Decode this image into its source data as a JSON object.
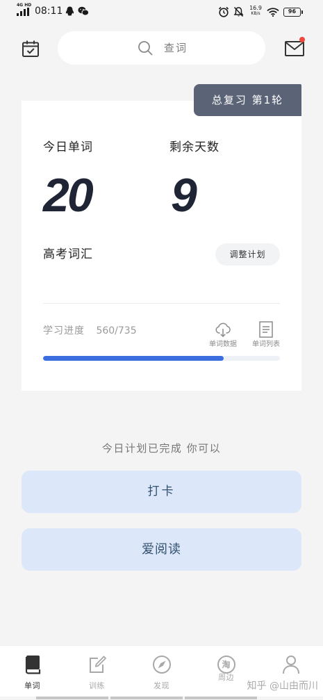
{
  "status_bar": {
    "network": "4G HD",
    "time": "08:11",
    "speed_value": "16.9",
    "speed_unit": "KB/s",
    "battery": "96"
  },
  "header": {
    "search_placeholder": "查词",
    "has_unread_mail": true
  },
  "plan_card": {
    "tag": "总复习 第1轮",
    "today_words_label": "今日单词",
    "today_words_value": "20",
    "remaining_days_label": "剩余天数",
    "remaining_days_value": "9",
    "book_name": "高考词汇",
    "adjust_button": "调整计划",
    "progress_label": "学习进度",
    "progress_text": "560/735",
    "progress_done": 560,
    "progress_total": 735,
    "word_data_label": "单词数据",
    "word_list_label": "单词列表"
  },
  "completion_message": "今日计划已完成 你可以",
  "actions": {
    "checkin_label": "打卡",
    "reading_label": "爱阅读"
  },
  "tabs": [
    {
      "label": "单词",
      "icon": "book-icon",
      "active": true
    },
    {
      "label": "训练",
      "icon": "edit-icon",
      "active": false
    },
    {
      "label": "发现",
      "icon": "compass-icon",
      "active": false
    },
    {
      "label": "周边",
      "icon": "tao-icon",
      "icon_text": "淘",
      "active": false
    },
    {
      "icon": "person-icon",
      "active": false
    }
  ],
  "watermark": "知乎 @山由而川",
  "colors": {
    "page_bg": "#f4f4f4",
    "card_bg": "#ffffff",
    "tag_bg": "#5b6477",
    "number": "#1f2535",
    "accent": "#3d6ee0",
    "track": "#eef1f6",
    "action_bg": "#dce8fa",
    "action_text": "#33506f",
    "badge": "#f0483a",
    "tab_active": "#333333",
    "tab_inactive": "#a8a8a8"
  }
}
